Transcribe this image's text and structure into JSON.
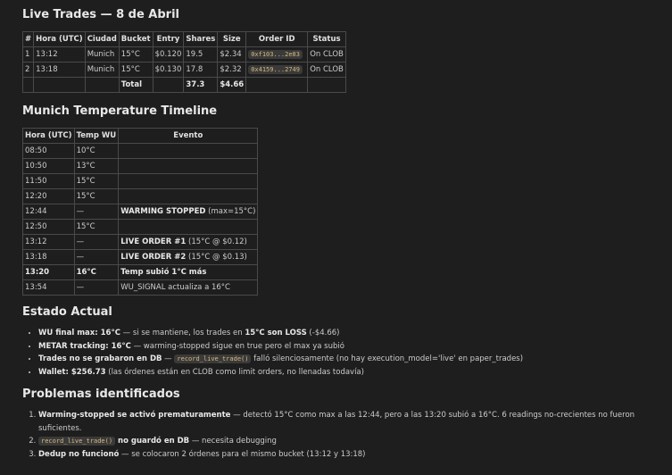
{
  "trades": {
    "title": "Live Trades — 8 de Abril",
    "headers": [
      "#",
      "Hora (UTC)",
      "Ciudad",
      "Bucket",
      "Entry",
      "Shares",
      "Size",
      "Order ID",
      "Status"
    ],
    "rows": [
      [
        "1",
        "13:12",
        "Munich",
        "15°C",
        "$0.120",
        "19.5",
        "$2.34",
        "0xf103...2e83",
        "On CLOB"
      ],
      [
        "2",
        "13:18",
        "Munich",
        "15°C",
        "$0.130",
        "17.8",
        "$2.32",
        "0x4159...2749",
        "On CLOB"
      ]
    ],
    "total_label": "Total",
    "total_shares": "37.3",
    "total_size": "$4.66"
  },
  "timeline": {
    "title": "Munich Temperature Timeline",
    "headers": [
      "Hora (UTC)",
      "Temp WU",
      "Evento"
    ],
    "rows": [
      {
        "hora": "08:50",
        "temp": "10°C",
        "evento_bold": "",
        "evento_rest": ""
      },
      {
        "hora": "10:50",
        "temp": "13°C",
        "evento_bold": "",
        "evento_rest": ""
      },
      {
        "hora": "11:50",
        "temp": "15°C",
        "evento_bold": "",
        "evento_rest": ""
      },
      {
        "hora": "12:20",
        "temp": "15°C",
        "evento_bold": "",
        "evento_rest": ""
      },
      {
        "hora": "12:44",
        "temp": "—",
        "evento_bold": "WARMING STOPPED",
        "evento_rest": " (max=15°C)"
      },
      {
        "hora": "12:50",
        "temp": "15°C",
        "evento_bold": "",
        "evento_rest": ""
      },
      {
        "hora": "13:12",
        "temp": "—",
        "evento_bold": "LIVE ORDER #1",
        "evento_rest": " (15°C @ $0.12)"
      },
      {
        "hora": "13:18",
        "temp": "—",
        "evento_bold": "LIVE ORDER #2",
        "evento_rest": " (15°C @ $0.13)"
      },
      {
        "hora": "13:20",
        "temp": "16°C",
        "evento_bold": "Temp subió 1°C más",
        "evento_rest": "",
        "all_bold": true
      },
      {
        "hora": "13:54",
        "temp": "—",
        "evento_bold": "",
        "evento_rest": "WU_SIGNAL actualiza a 16°C"
      }
    ]
  },
  "estado": {
    "title": "Estado Actual",
    "items": [
      {
        "b1": "WU final max: 16°C",
        "t1": " — si se mantiene, los trades en ",
        "b2": "15°C son LOSS",
        "t2": " (-$4.66)"
      },
      {
        "b1": "METAR tracking: 16°C",
        "t1": " — warming-stopped sigue en true pero el max ya subió"
      },
      {
        "b1": "Trades no se grabaron en DB",
        "t1": " — ",
        "code": "record_live_trade()",
        "t2": " falló silenciosamente (no hay execution_model='live' en paper_trades)"
      },
      {
        "b1": "Wallet: $256.73",
        "t1": " (las órdenes están en CLOB como limit orders, no llenadas todavía)"
      }
    ]
  },
  "problemas": {
    "title": "Problemas identificados",
    "items": [
      {
        "b1": "Warming-stopped se activó prematuramente",
        "t1": " — detectó 15°C como max a las 12:44, pero a las 13:20 subió a 16°C. 6 readings no-crecientes no fueron suficientes."
      },
      {
        "code": "record_live_trade()",
        "b1": " no guardó en DB",
        "t1": " — necesita debugging"
      },
      {
        "b1": "Dedup no funcionó",
        "t1": " — se colocaron 2 órdenes para el mismo bucket (13:12 y 13:18)"
      }
    ]
  }
}
